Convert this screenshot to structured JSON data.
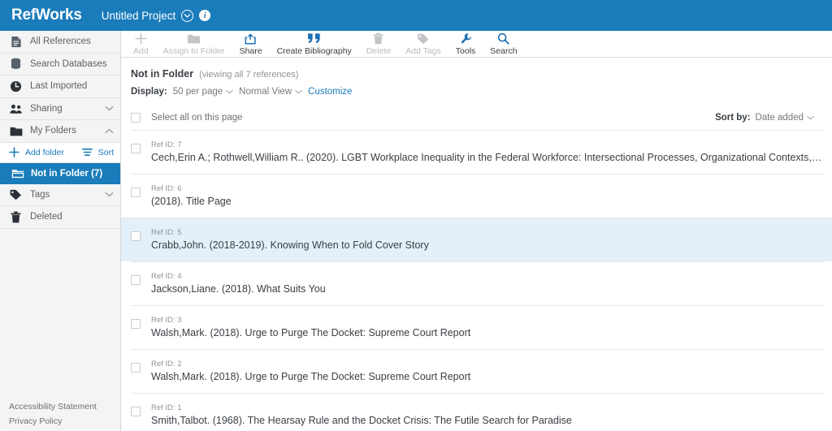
{
  "header": {
    "logo": "RefWorks",
    "project_name": "Untitled Project",
    "project_chevron_icon": "chevron-down-circle-icon",
    "info_icon": "info-icon",
    "info_glyph": "i",
    "background_color": "#1a7cba"
  },
  "toolbar": {
    "items": [
      {
        "label": "Add",
        "icon": "plus-icon",
        "enabled": false
      },
      {
        "label": "Assign to Folder",
        "icon": "folder-icon",
        "enabled": false
      },
      {
        "label": "Share",
        "icon": "share-icon",
        "enabled": true
      },
      {
        "label": "Create Bibliography",
        "icon": "quote-icon",
        "enabled": true
      },
      {
        "label": "Delete",
        "icon": "trash-icon",
        "enabled": false
      },
      {
        "label": "Add Tags",
        "icon": "tag-icon",
        "enabled": false
      },
      {
        "label": "Tools",
        "icon": "wrench-icon",
        "enabled": true
      },
      {
        "label": "Search",
        "icon": "search-icon",
        "enabled": true
      }
    ]
  },
  "sidebar": {
    "items": [
      {
        "label": "All References",
        "icon": "document-icon",
        "chevron": ""
      },
      {
        "label": "Search Databases",
        "icon": "database-icon",
        "chevron": ""
      },
      {
        "label": "Last Imported",
        "icon": "clock-icon",
        "chevron": ""
      },
      {
        "label": "Sharing",
        "icon": "people-icon",
        "chevron": "∨"
      },
      {
        "label": "My Folders",
        "icon": "folder-icon",
        "chevron": "∧"
      }
    ],
    "add_folder": {
      "label": "Add folder",
      "icon": "plus-icon"
    },
    "sort": {
      "label": "Sort",
      "icon": "sort-lines-icon"
    },
    "selected_folder": {
      "label": "Not in Folder (7)",
      "icon": "open-folder-icon"
    },
    "tail_items": [
      {
        "label": "Tags",
        "icon": "tag-icon",
        "chevron": "∨"
      },
      {
        "label": "Deleted",
        "icon": "trash-icon",
        "chevron": ""
      }
    ],
    "footer_links": [
      {
        "label": "Accessibility Statement"
      },
      {
        "label": "Privacy Policy"
      }
    ],
    "accent_color": "#1a7cba"
  },
  "main": {
    "breadcrumb_title": "Not in Folder",
    "breadcrumb_sub": "(viewing all 7 references)",
    "display_label": "Display:",
    "per_page": "50 per page",
    "view_mode": "Normal View",
    "customize_link": "Customize",
    "select_all_label": "Select all on this page",
    "sort_by_label": "Sort by:",
    "sort_by_value": "Date added",
    "chevron_glyph": "∨"
  },
  "references": [
    {
      "ref_id": "Ref ID: 7",
      "citation": "Cech,Erin A.; Rothwell,William R.. (2020). LGBT Workplace Inequality in the Federal Workforce: Intersectional Processes, Organizational Contexts, and Turnover Consi...",
      "selected": false,
      "highlighted": false
    },
    {
      "ref_id": "Ref ID: 6",
      "citation": "(2018). Title Page",
      "selected": false,
      "highlighted": false
    },
    {
      "ref_id": "Ref ID: 5",
      "citation": "Crabb,John. (2018-2019). Knowing When to Fold Cover Story",
      "selected": false,
      "highlighted": true
    },
    {
      "ref_id": "Ref ID: 4",
      "citation": "Jackson,Liane. (2018). What Suits You",
      "selected": false,
      "highlighted": false
    },
    {
      "ref_id": "Ref ID: 3",
      "citation": "Walsh,Mark. (2018). Urge to Purge The Docket: Supreme Court Report",
      "selected": false,
      "highlighted": false
    },
    {
      "ref_id": "Ref ID: 2",
      "citation": "Walsh,Mark. (2018). Urge to Purge The Docket: Supreme Court Report",
      "selected": false,
      "highlighted": false
    },
    {
      "ref_id": "Ref ID: 1",
      "citation": "Smith,Talbot. (1968). The Hearsay Rule and the Docket Crisis: The Futile Search for Paradise",
      "selected": false,
      "highlighted": false
    }
  ]
}
